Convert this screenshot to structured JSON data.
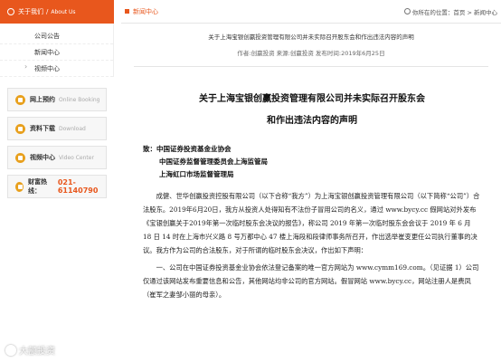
{
  "sidebar": {
    "header": {
      "title": "关于我们",
      "separator": "/",
      "title_en": "About Us"
    },
    "items": [
      {
        "label": "公司公告"
      },
      {
        "label": "新闻中心"
      },
      {
        "label": "视频中心"
      }
    ],
    "boxes": [
      {
        "label": "网上预约",
        "en": "Online Booking"
      },
      {
        "label": "资料下载",
        "en": "Download"
      },
      {
        "label": "视频中心",
        "en": "Video Center"
      },
      {
        "label": "财富热线：",
        "phone": "021-61140790"
      }
    ],
    "watermark": "大额投资"
  },
  "topbar": {
    "section": "新闻中心",
    "breadcrumb": "你所在的位置：首页 > 新闻中心"
  },
  "article": {
    "title_small": "关于上海宝银创赢投资管理有限公司并未实际召开股东会和作出违法内容的声明",
    "meta": "作者:创赢投资 来源:创赢投资 发布时间:2019年6月25日",
    "doc_title_line1": "关于上海宝银创赢投资管理有限公司并未实际召开股东会",
    "doc_title_line2": "和作出违法内容的声明",
    "addressees": [
      "致：中国证券投资基金业协会",
      "中国证券监督管理委员会上海监管局",
      "上海虹口市场监督管理局"
    ],
    "paragraph1": "成健、世华创赢投资控股有限公司（以下合称“我方”）为上海宝银创赢投资管理有限公司（以下简称“公司”）合法股东。2019年6月20日，我方从投资人处得知有不法份子冒用公司的名义，通过 www.bycy.cc 假网站对外发布《宝银创赢关于2019年第一次临时股东会决议的报告》，称公司 2019 年第一次临时股东会会议于 2019 年 6 月 18 日 14 时在上海市兴义路 8 号万都中心 47 楼上海段和段律师事务所召开，作出选举崔变更任公司执行董事的决议。我方作为公司的合法股东，对于所谓的临时股东会决议，作出如下声明：",
    "paragraph2": "一、公司在中国证券投资基金业协会依法登记备案的唯一官方网站为 www.cymm169.com。（见证据 1）公司仅通过该网站发布重要信息和公告，其他网站均非公司的官方网站。假冒网站 www.bycy.cc，网站注册人是费凤（崔军之妻邹小丽的母亲）。"
  }
}
